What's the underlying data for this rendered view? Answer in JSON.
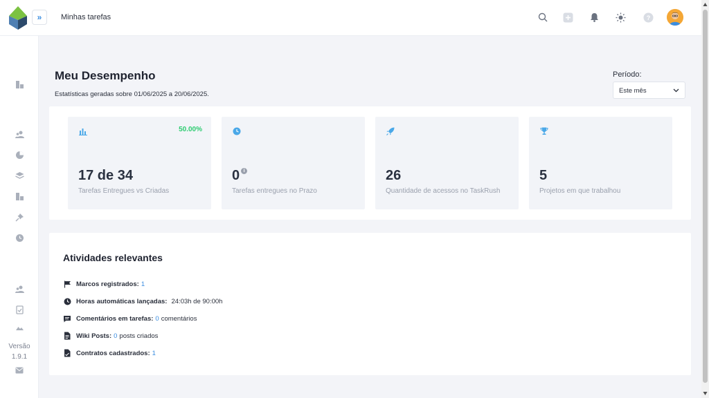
{
  "header": {
    "page_title": "Minhas tarefas",
    "icons": [
      "search-icon",
      "add-icon",
      "bell-icon",
      "brightness-icon",
      "help-icon"
    ]
  },
  "sidebar": {
    "icons": [
      "dashboard-icon",
      "team-icon",
      "pie-chart-icon",
      "layers-icon",
      "dashboard-icon",
      "pin-icon",
      "clock-icon",
      "team-icon",
      "checklist-icon",
      "image-icon"
    ],
    "version_label": "Versão",
    "version_number": "1.9.1",
    "mail_icon": "mail-icon"
  },
  "performance": {
    "title": "Meu Desempenho",
    "subtitle": "Estatísticas geradas sobre 01/06/2025 a 20/06/2025.",
    "period_label": "Período:",
    "period_value": "Este mês"
  },
  "stats": [
    {
      "value": "17 de 34",
      "label": "Tarefas Entregues vs Criadas",
      "percent": "50.00%",
      "icon": "bar-chart-icon"
    },
    {
      "value": "0",
      "label": "Tarefas entregues no Prazo",
      "icon": "clock-icon",
      "info": "i"
    },
    {
      "value": "26",
      "label": "Quantidade de acessos no TaskRush",
      "icon": "rocket-icon"
    },
    {
      "value": "5",
      "label": "Projetos em que trabalhou",
      "icon": "trophy-icon"
    }
  ],
  "activities": {
    "title": "Atividades relevantes",
    "items": [
      {
        "label": "Marcos registrados:",
        "value": "1",
        "suffix": "",
        "icon": "flag-icon"
      },
      {
        "label": "Horas automáticas lançadas:",
        "value": "",
        "suffix": "24:03h de 90:00h",
        "icon": "clock-icon"
      },
      {
        "label": "Comentários em tarefas:",
        "value": "0",
        "suffix": "comentários",
        "icon": "comment-icon"
      },
      {
        "label": "Wiki Posts:",
        "value": "0",
        "suffix": "posts criados",
        "icon": "document-icon"
      },
      {
        "label": "Contratos cadastrados:",
        "value": "1",
        "suffix": "",
        "icon": "contract-icon"
      }
    ]
  },
  "colors": {
    "accent": "#3b8de0",
    "success": "#2ecc71",
    "logo_green": "#7cc242",
    "logo_blue": "#2c4a6b",
    "icon_blue": "#4aa8e8"
  }
}
